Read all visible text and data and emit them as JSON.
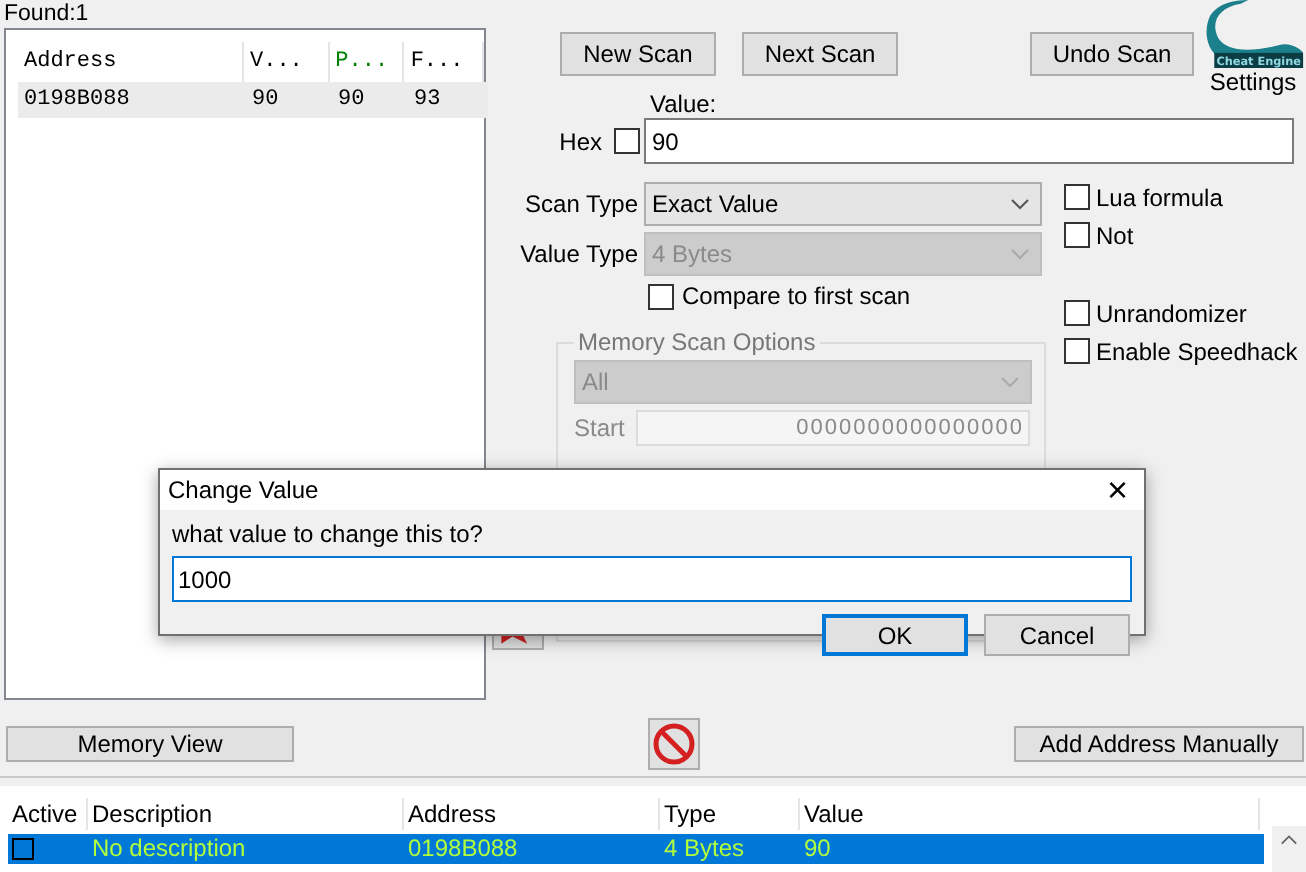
{
  "found_label": "Found:1",
  "results": {
    "columns": [
      {
        "label": "Address",
        "color": "#000000"
      },
      {
        "label": "V...",
        "color": "#000000"
      },
      {
        "label": "P...",
        "color": "#008000"
      },
      {
        "label": "F...",
        "color": "#000000"
      }
    ],
    "rows": [
      {
        "cells": [
          "0198B088",
          "90",
          "90",
          "93"
        ],
        "selected": true
      }
    ]
  },
  "scan_buttons": [
    "New Scan",
    "Next Scan",
    "Undo Scan"
  ],
  "logo_text": "Cheat Engine",
  "settings_label": "Settings",
  "value": {
    "label": "Value:",
    "value": "90"
  },
  "hex": {
    "label": "Hex",
    "checked": false
  },
  "scan_type": {
    "label": "Scan Type",
    "value": "Exact Value",
    "disabled": false
  },
  "value_type": {
    "label": "Value Type",
    "value": "4 Bytes",
    "disabled": true
  },
  "compare_first": {
    "label": "Compare to first scan",
    "checked": false
  },
  "options": [
    {
      "label": "Lua formula",
      "checked": false
    },
    {
      "label": "Not",
      "checked": false
    }
  ],
  "extras": [
    {
      "label": "Unrandomizer",
      "checked": false
    },
    {
      "label": "Enable Speedhack",
      "checked": false
    }
  ],
  "memory_scan_options": {
    "title": "Memory Scan Options",
    "region": "All",
    "start_label": "Start",
    "start": "0000000000000000"
  },
  "memory_view_button": "Memory View",
  "add_address_button": "Add Address Manually",
  "address_list": {
    "active_column": "Active",
    "columns": [
      "Description",
      "Address",
      "Type",
      "Value"
    ],
    "rows": [
      {
        "active": false,
        "selected": true,
        "cells": [
          "No description",
          "0198B088",
          "4 Bytes",
          "90"
        ]
      }
    ]
  },
  "dialog": {
    "title": "Change Value",
    "close": "×",
    "prompt": "what value to change this to?",
    "value": "1000",
    "buttons": [
      {
        "label": "OK",
        "default": true
      },
      {
        "label": "Cancel",
        "default": false
      }
    ]
  }
}
